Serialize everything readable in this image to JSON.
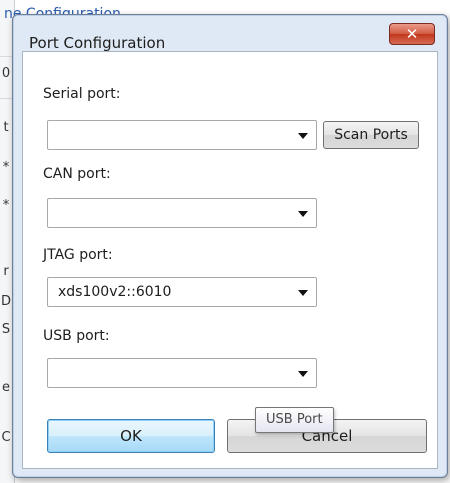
{
  "background": {
    "title": "ne Configuration",
    "edge_chars": [
      "0",
      "t",
      "*",
      "*",
      "r",
      "D",
      "S",
      "e",
      "C"
    ]
  },
  "dialog": {
    "title": "Port Configuration",
    "close_icon": "close-icon",
    "serial": {
      "label": "Serial port:",
      "value": "",
      "scan_label": "Scan Ports"
    },
    "can": {
      "label": "CAN port:",
      "value": ""
    },
    "jtag": {
      "label": "JTAG port:",
      "value": "xds100v2::6010"
    },
    "usb": {
      "label": "USB port:",
      "value": ""
    },
    "tooltip": "USB Port",
    "ok_label": "OK",
    "cancel_label": "Cancel"
  },
  "colors": {
    "frame": "#dfe9f5",
    "close": "#c2351c",
    "primary_button": "#bee6fd"
  }
}
